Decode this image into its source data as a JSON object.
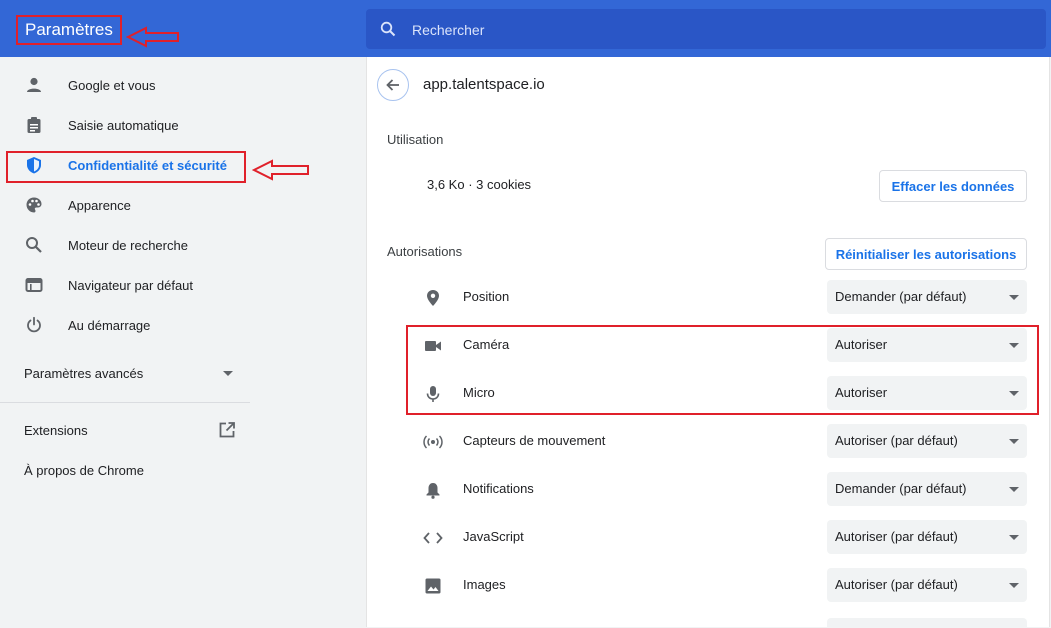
{
  "header": {
    "title": "Paramètres",
    "search_placeholder": "Rechercher"
  },
  "sidebar": {
    "items": [
      {
        "label": "Google et vous",
        "icon": "person-icon"
      },
      {
        "label": "Saisie automatique",
        "icon": "clipboard-icon"
      },
      {
        "label": "Confidentialité et sécurité",
        "icon": "shield-icon"
      },
      {
        "label": "Apparence",
        "icon": "palette-icon"
      },
      {
        "label": "Moteur de recherche",
        "icon": "search-icon"
      },
      {
        "label": "Navigateur par défaut",
        "icon": "browser-icon"
      },
      {
        "label": "Au démarrage",
        "icon": "power-icon"
      }
    ],
    "advanced": "Paramètres avancés",
    "extensions": "Extensions",
    "about": "À propos de Chrome"
  },
  "site": {
    "name": "app.talentspace.io",
    "usage_title": "Utilisation",
    "usage_value": "3,6 Ko · 3 cookies",
    "clear_button": "Effacer les données",
    "permissions_title": "Autorisations",
    "reset_button": "Réinitialiser les autorisations",
    "permissions": [
      {
        "label": "Position",
        "value": "Demander (par défaut)",
        "icon": "location-pin-icon"
      },
      {
        "label": "Caméra",
        "value": "Autoriser",
        "icon": "camera-icon"
      },
      {
        "label": "Micro",
        "value": "Autoriser",
        "icon": "microphone-icon"
      },
      {
        "label": "Capteurs de mouvement",
        "value": "Autoriser (par défaut)",
        "icon": "motion-sensor-icon"
      },
      {
        "label": "Notifications",
        "value": "Demander (par défaut)",
        "icon": "bell-icon"
      },
      {
        "label": "JavaScript",
        "value": "Autoriser (par défaut)",
        "icon": "code-icon"
      },
      {
        "label": "Images",
        "value": "Autoriser (par défaut)",
        "icon": "image-icon"
      }
    ]
  },
  "colors": {
    "header_bg": "#3367d6",
    "accent": "#1a73e8",
    "annotation": "#e0202a"
  }
}
